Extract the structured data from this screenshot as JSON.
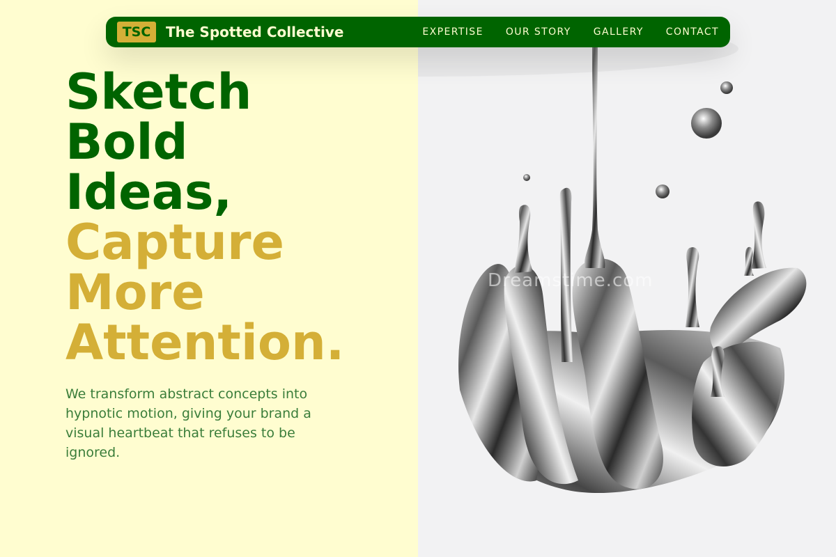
{
  "brand": {
    "logo_text": "TSC",
    "name": "The Spotted Collective"
  },
  "nav": {
    "items": [
      "EXPERTISE",
      "OUR STORY",
      "GALLERY",
      "CONTACT"
    ]
  },
  "hero": {
    "title_lines_green": [
      "Sketch",
      "Bold",
      "Ideas,"
    ],
    "title_lines_gold": [
      "Capture",
      "More",
      "Attention."
    ],
    "description": "We transform abstract concepts into hypnotic motion, giving your brand a visual heartbeat that refuses to be ignored."
  },
  "image": {
    "subject": "liquid-chrome-splash",
    "watermark": "Dreamstime.com"
  },
  "colors": {
    "primary_green": "#006400",
    "accent_gold": "#d4af37",
    "cream_background": "#fffdd0",
    "image_background": "#f2f2f3"
  }
}
